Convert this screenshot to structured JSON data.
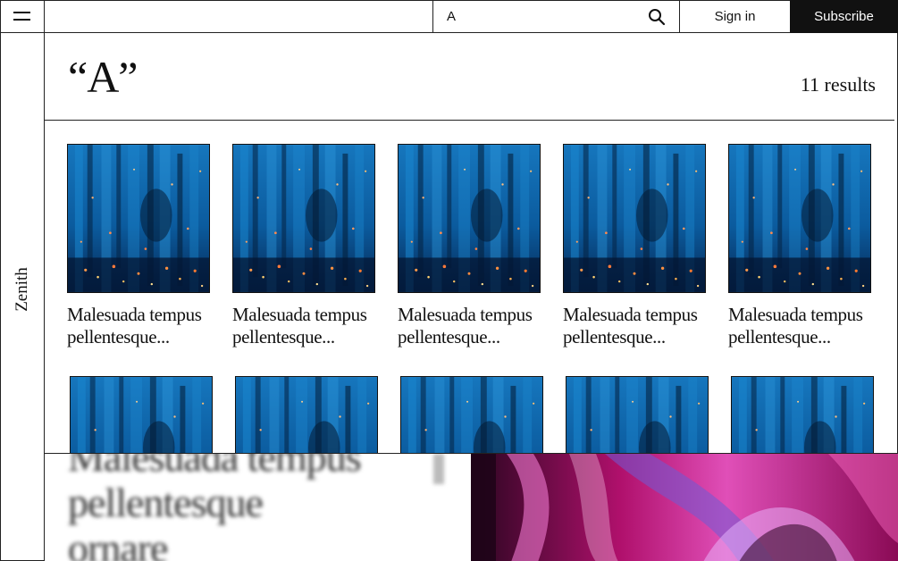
{
  "brand": {
    "name": "Zenith"
  },
  "header": {
    "search": {
      "value": "A",
      "placeholder": ""
    },
    "sign_in_label": "Sign in",
    "subscribe_label": "Subscribe"
  },
  "results": {
    "query_display": "“A”",
    "count_label": "11 results"
  },
  "cards": [
    {
      "caption_line1": "Malesuada tempus",
      "caption_line2": "pellentesque..."
    },
    {
      "caption_line1": "Malesuada tempus",
      "caption_line2": "pellentesque..."
    },
    {
      "caption_line1": "Malesuada tempus",
      "caption_line2": "pellentesque..."
    },
    {
      "caption_line1": "Malesuada tempus",
      "caption_line2": "pellentesque..."
    },
    {
      "caption_line1": "Malesuada tempus",
      "caption_line2": "pellentesque..."
    }
  ],
  "overlay": {
    "line1": "Malesuada tempus",
    "line2": "pellentesque",
    "line3": "ornare"
  },
  "colors": {
    "ink": "#111111",
    "thumb_blue": "#0b5fa3",
    "art_magenta": "#c0147a"
  },
  "icons": {
    "menu": "hamburger-icon",
    "search": "search-icon"
  }
}
